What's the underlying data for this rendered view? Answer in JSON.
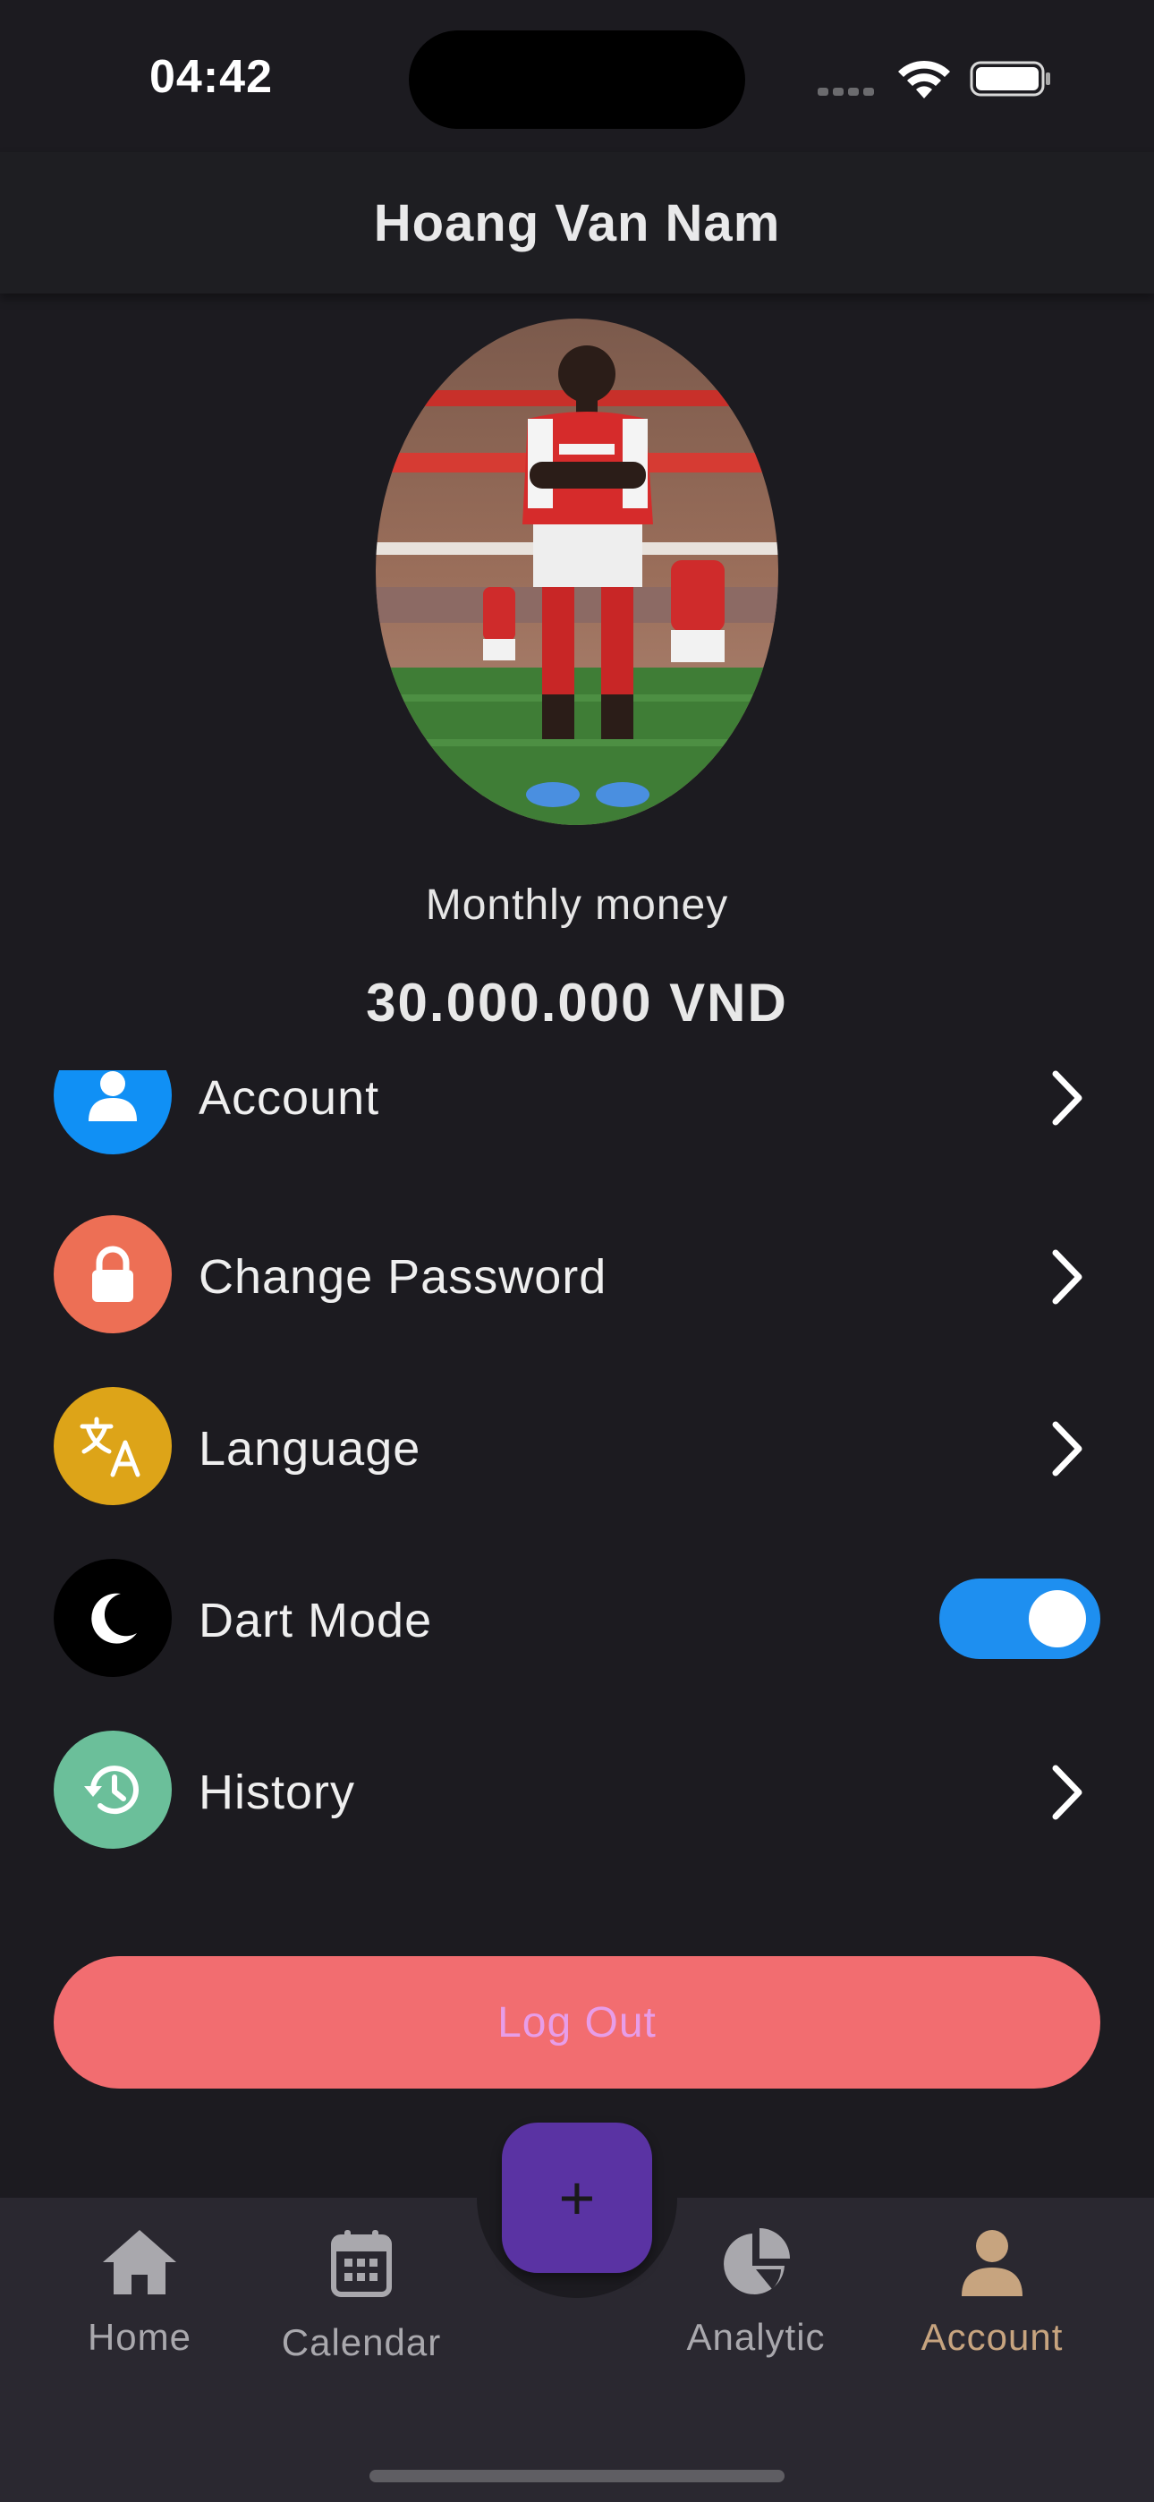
{
  "status_bar": {
    "time": "04:42"
  },
  "header": {
    "title": "Hoang Van Nam"
  },
  "profile": {
    "money_label": "Monthly money",
    "money_value": "30.000.000 VND"
  },
  "menu": {
    "items": [
      {
        "label": "Account",
        "icon": "user-icon",
        "color": "#1090f5"
      },
      {
        "label": "Change Password",
        "icon": "lock-icon",
        "color": "#ed6f55"
      },
      {
        "label": "Language",
        "icon": "translate-icon",
        "color": "#dda418"
      },
      {
        "label": "Dart Mode",
        "icon": "moon-icon",
        "color": "#000000",
        "toggle_on": true
      },
      {
        "label": "History",
        "icon": "history-icon",
        "color": "#6bbf9a"
      }
    ]
  },
  "logout": {
    "label": "Log Out"
  },
  "fab": {
    "label": "+"
  },
  "nav": {
    "items": [
      {
        "label": "Home",
        "icon": "home-icon"
      },
      {
        "label": "Calendar",
        "icon": "calendar-icon"
      },
      {
        "label": "Analytic",
        "icon": "pie-chart-icon"
      },
      {
        "label": "Account",
        "icon": "person-icon",
        "active": true
      }
    ]
  },
  "colors": {
    "background": "#1c1b20",
    "nav_background": "#2a2830",
    "fab": "#5a33a3",
    "logout": "#f26d70",
    "toggle": "#1e8ff0",
    "active_nav": "#c7a47f"
  }
}
